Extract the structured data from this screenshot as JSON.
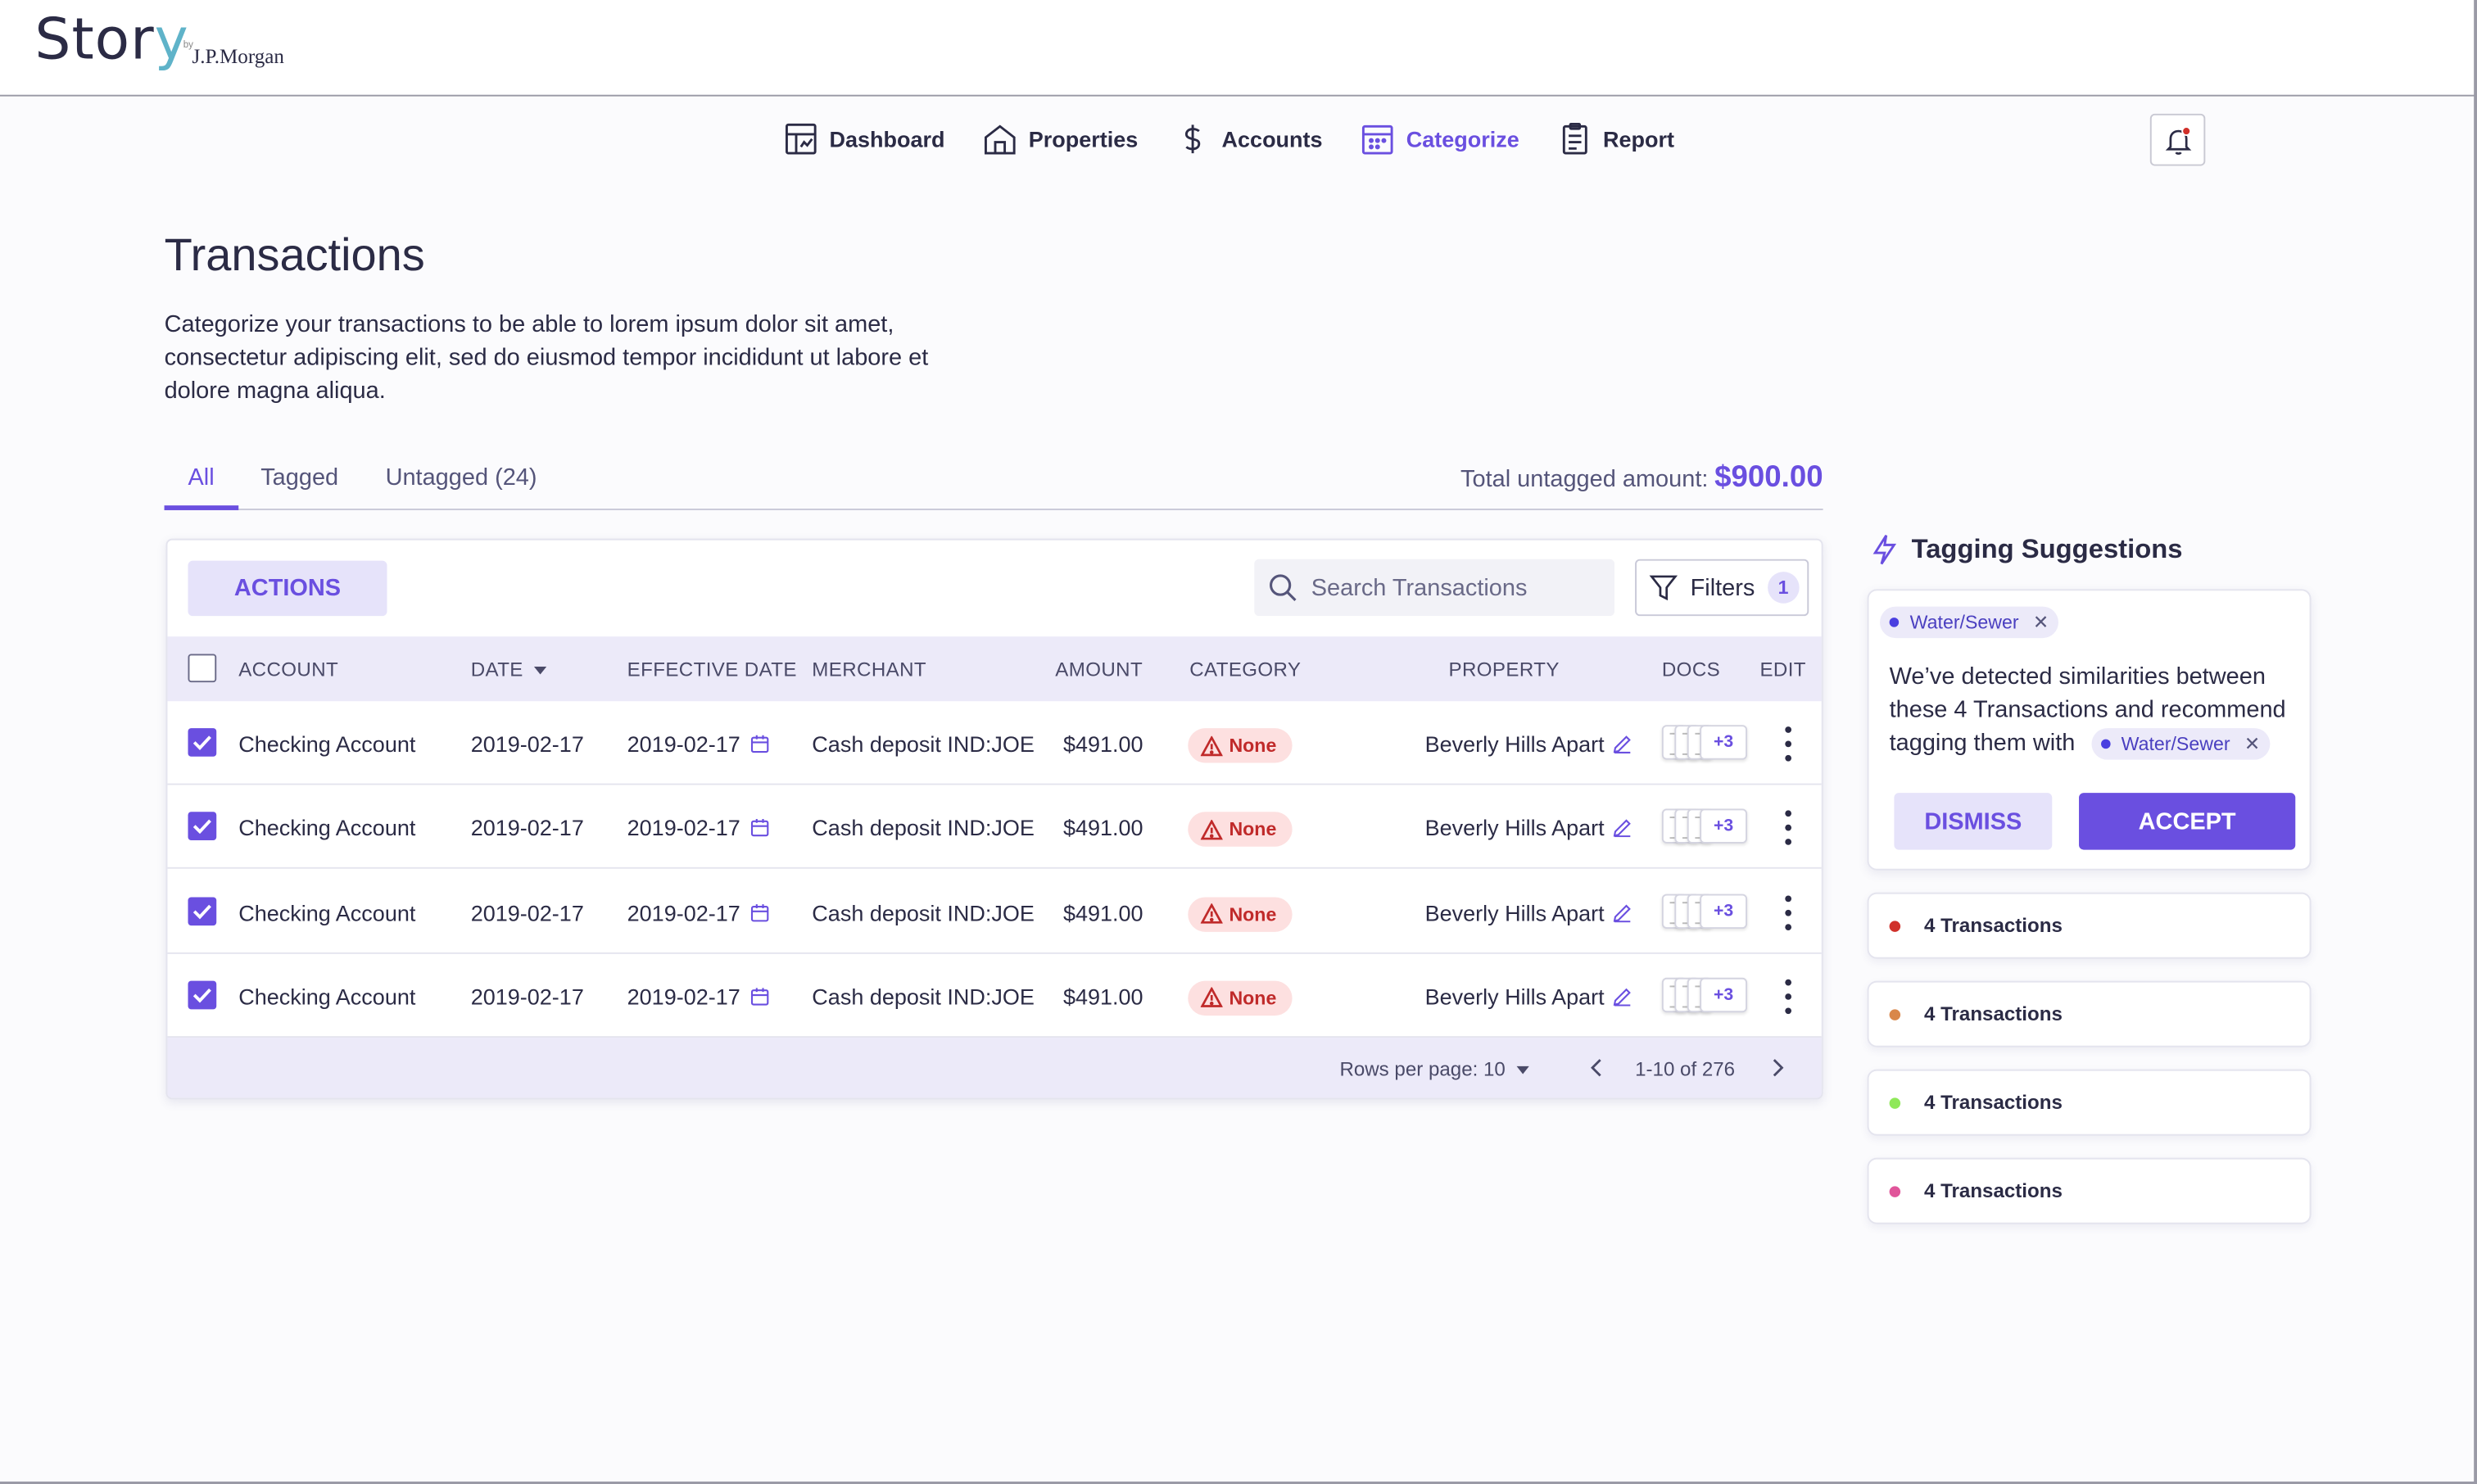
{
  "brand": {
    "name_main": "Stor",
    "name_accent": "y",
    "by": "by",
    "partner": "J.P.Morgan"
  },
  "nav": {
    "items": [
      {
        "label": "Dashboard",
        "icon": "dashboard-icon"
      },
      {
        "label": "Properties",
        "icon": "house-icon"
      },
      {
        "label": "Accounts",
        "icon": "dollar-icon"
      },
      {
        "label": "Categorize",
        "icon": "calendar-grid-icon",
        "active": true
      },
      {
        "label": "Report",
        "icon": "clipboard-icon"
      }
    ],
    "notification_icon": "bell-icon"
  },
  "page": {
    "title": "Transactions",
    "description": "Categorize your transactions to be able to lorem ipsum dolor sit amet, consectetur adipiscing elit, sed do eiusmod tempor incididunt ut labore et dolore magna aliqua."
  },
  "tabs": [
    {
      "label": "All",
      "active": true
    },
    {
      "label": "Tagged"
    },
    {
      "label": "Untagged (24)"
    }
  ],
  "total": {
    "label": "Total untagged amount:",
    "amount": "$900.00"
  },
  "toolbar": {
    "actions_label": "ACTIONS",
    "search_placeholder": "Search Transactions",
    "filters_label": "Filters",
    "filters_count": "1"
  },
  "table": {
    "columns": [
      "ACCOUNT",
      "DATE",
      "EFFECTIVE DATE",
      "MERCHANT",
      "AMOUNT",
      "CATEGORY",
      "PROPERTY",
      "DOCS",
      "EDIT"
    ],
    "rows": [
      {
        "account": "Checking Account",
        "date": "2019-02-17",
        "effective_date": "2019-02-17",
        "merchant": "Cash deposit IND:JOE",
        "amount": "$491.00",
        "category": "None",
        "property": "Beverly Hills Apart",
        "docs_more": "+3",
        "checked": true
      },
      {
        "account": "Checking Account",
        "date": "2019-02-17",
        "effective_date": "2019-02-17",
        "merchant": "Cash deposit IND:JOE",
        "amount": "$491.00",
        "category": "None",
        "property": "Beverly Hills Apart",
        "docs_more": "+3",
        "checked": true
      },
      {
        "account": "Checking Account",
        "date": "2019-02-17",
        "effective_date": "2019-02-17",
        "merchant": "Cash deposit IND:JOE",
        "amount": "$491.00",
        "category": "None",
        "property": "Beverly Hills Apart",
        "docs_more": "+3",
        "checked": true
      },
      {
        "account": "Checking Account",
        "date": "2019-02-17",
        "effective_date": "2019-02-17",
        "merchant": "Cash deposit IND:JOE",
        "amount": "$491.00",
        "category": "None",
        "property": "Beverly Hills Apart",
        "docs_more": "+3",
        "checked": true
      }
    ],
    "footer": {
      "rows_per_page": "Rows per page: 10",
      "range": "1-10 of 276"
    }
  },
  "suggestions": {
    "title": "Tagging Suggestions",
    "card": {
      "tag": "Water/Sewer",
      "text": "We’ve detected similarities between these 4 Transactions and recommend tagging them with",
      "dismiss_label": "DISMISS",
      "accept_label": "ACCEPT"
    },
    "items": [
      {
        "label": "4 Transactions",
        "color": "#d0302a"
      },
      {
        "label": "4 Transactions",
        "color": "#d9874a"
      },
      {
        "label": "4 Transactions",
        "color": "#8fe85a"
      },
      {
        "label": "4 Transactions",
        "color": "#e0559a"
      }
    ]
  },
  "colors": {
    "accent": "#6a4fe0",
    "danger": "#c02a2a"
  }
}
